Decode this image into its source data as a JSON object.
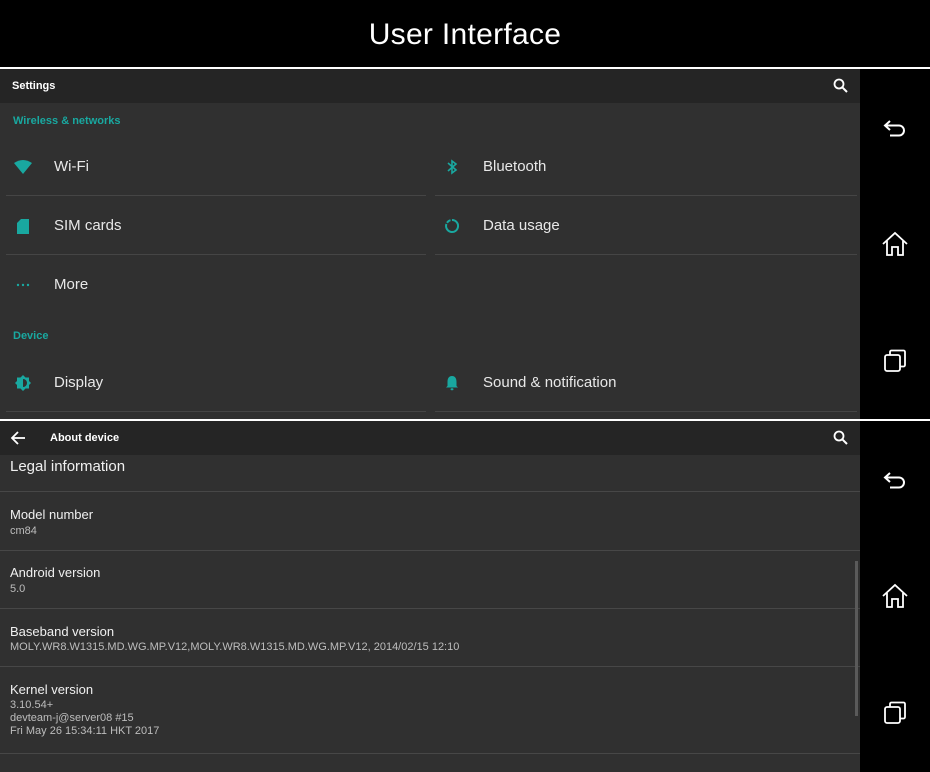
{
  "banner": {
    "title": "User Interface"
  },
  "settings": {
    "toolbar_title": "Settings",
    "sections": [
      {
        "header": "Wireless & networks",
        "items": [
          {
            "label": "Wi-Fi",
            "icon": "wifi-icon"
          },
          {
            "label": "Bluetooth",
            "icon": "bluetooth-icon"
          },
          {
            "label": "SIM cards",
            "icon": "sim-card-icon"
          },
          {
            "label": "Data usage",
            "icon": "data-usage-icon"
          },
          {
            "label": "More",
            "icon": "more-icon"
          }
        ]
      },
      {
        "header": "Device",
        "items": [
          {
            "label": "Display",
            "icon": "display-icon"
          },
          {
            "label": "Sound & notification",
            "icon": "bell-icon"
          }
        ]
      }
    ]
  },
  "about": {
    "toolbar_title": "About device",
    "rows": [
      {
        "title": "Legal information",
        "summary": ""
      },
      {
        "title": "Model number",
        "summary": "cm84"
      },
      {
        "title": "Android version",
        "summary": "5.0"
      },
      {
        "title": "Baseband version",
        "summary": "MOLY.WR8.W1315.MD.WG.MP.V12,MOLY.WR8.W1315.MD.WG.MP.V12, 2014/02/15 12:10"
      },
      {
        "title": "Kernel version",
        "summary": "3.10.54+\ndevteam-j@server08 #15\nFri May 26 15:34:11 HKT 2017"
      }
    ]
  },
  "colors": {
    "accent": "#19a8a0",
    "background": "#303030",
    "toolbar": "#252525",
    "navbar": "#000000"
  }
}
